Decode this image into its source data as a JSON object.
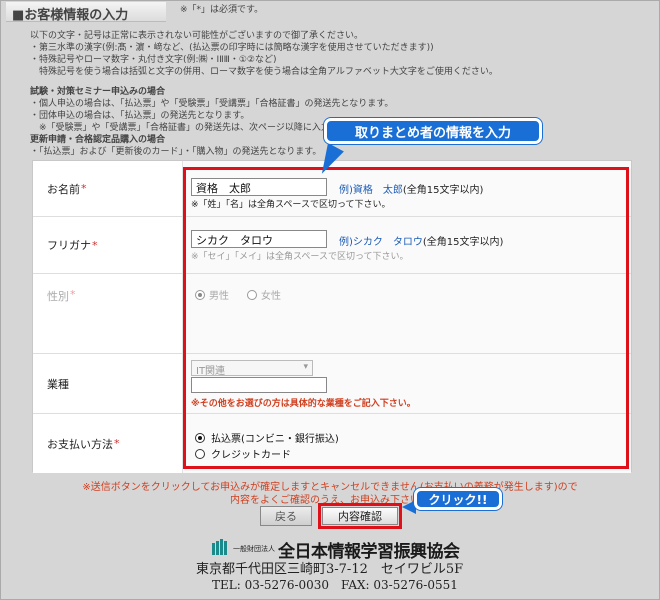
{
  "header": {
    "title": "■お客様情報の入力",
    "required_note": "※「*」は必須です。"
  },
  "notes": {
    "lines": [
      "以下の文字・記号は正常に表示されない可能性がございますので御了承ください。",
      "・第三水準の漢字(例:髙・濵・﨑など、(払込票の印字時には簡略な漢字を使用させていただきます))",
      "・特殊記号やローマ数字・丸付き文字(例:㈱・ⅠⅡⅢ・①②など)",
      "　特殊記号を使う場合は括弧と文字の併用、ローマ数字を使う場合は全角アルファベット大文字をご使用ください。"
    ],
    "seminar_heading": "試験・対策セミナー申込みの場合",
    "seminar_lines": [
      "・個人申込の場合は、「払込票」や「受験票」「受講票」「合格証書」の発送先となります。",
      "・団体申込の場合は、「払込票」の発送先となります。",
      "　※「受験票」や「受講票」「合格証書」の発送先は、次ページ以降に入力"
    ],
    "renewal_heading": "更新申請・合格認定品購入の場合",
    "renewal_lines": [
      "・「払込票」および「更新後のカード」・「購入物」の発送先となります。"
    ]
  },
  "form": {
    "name": {
      "label": "お名前",
      "req": "*",
      "value": "資格　太郎",
      "example_prefix": "例)",
      "example_value": "資格　太郎",
      "example_suffix": "(全角15文字以内)",
      "hint": "※「姓」「名」は全角スペースで区切って下さい。"
    },
    "kana": {
      "label": "フリガナ",
      "req": "*",
      "value": "シカク　タロウ",
      "example_prefix": "例)",
      "example_value": "シカク　タロウ",
      "example_suffix": "(全角15文字以内)",
      "hint": "※「セイ」「メイ」は全角スペースで区切って下さい。"
    },
    "gender": {
      "label": "性別",
      "req": "*",
      "male": "男性",
      "female": "女性"
    },
    "industry": {
      "label": "業種",
      "selected": "IT関連",
      "other_value": "",
      "note": "※その他をお選びの方は具体的な業種をご記入下さい。"
    },
    "payment": {
      "label": "お支払い方法",
      "req": "*",
      "option1": "払込票(コンビニ・銀行振込)",
      "option2": "クレジットカード"
    }
  },
  "callouts": {
    "top": "取りまとめ者の情報を入力",
    "click": "クリック!!"
  },
  "warning": {
    "line1": "※送信ボタンをクリックしてお申込みが確定しますとキャンセルできません(お支払いの義務が発生します)ので",
    "line2": "内容をよくご確認のうえ、お申込み下さい。"
  },
  "buttons": {
    "back": "戻る",
    "confirm": "内容確認"
  },
  "footer": {
    "org_type": "一般財団法人",
    "org_name": "全日本情報学習振興協会",
    "address": "東京都千代田区三崎町3-7-12　セイワビル5F",
    "tel": "TEL: 03-5276-0030　FAX: 03-5276-0551"
  },
  "colors": {
    "highlight": "#e0101a",
    "callout": "#1a6fd6",
    "link_blue": "#1a5bb8",
    "warning_red": "#d04020"
  }
}
